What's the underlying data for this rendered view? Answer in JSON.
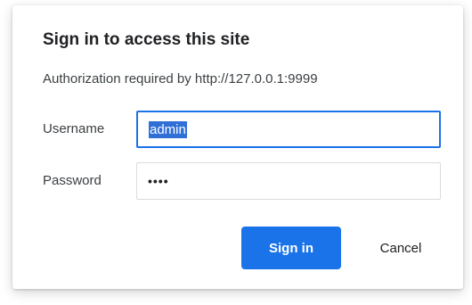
{
  "dialog": {
    "title": "Sign in to access this site",
    "subtitle": "Authorization required by http://127.0.0.1:9999"
  },
  "form": {
    "username_label": "Username",
    "username_value": "admin",
    "password_label": "Password",
    "password_masked": "••••"
  },
  "buttons": {
    "sign_in": "Sign in",
    "cancel": "Cancel"
  },
  "colors": {
    "primary": "#1a73e8",
    "selection": "#2f6fd6"
  }
}
